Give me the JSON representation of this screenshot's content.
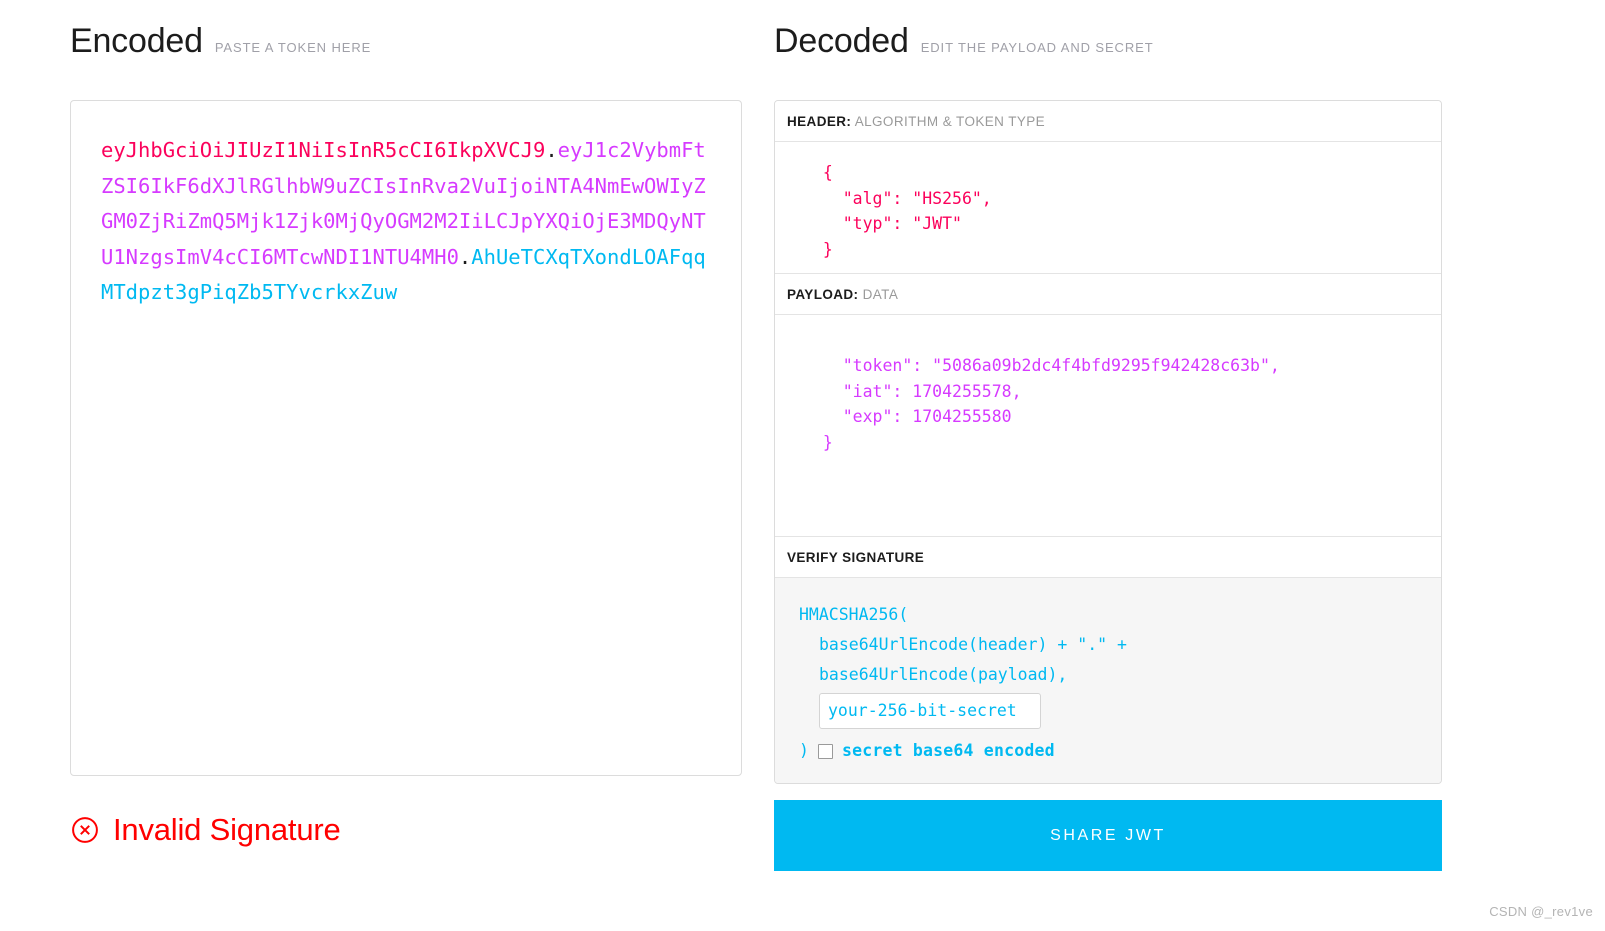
{
  "encoded": {
    "title": "Encoded",
    "subtitle": "PASTE A TOKEN HERE",
    "token": {
      "header_part": "eyJhbGciOiJIUzI1NiIsInR5cCI6IkpXVCJ9",
      "dot1": ".",
      "payload_part": "eyJ1c2VybmFtZSI6IkF6dXJlRGlhbW9uZCIsInRva2VuIjoiNTA4NmEwOWIyZGM0ZjRiZmQ5Mjk1Zjk0MjQyOGM2M2IiLCJpYXQiOjE3MDQyNTU1NzgsImV4cCI6MTcwNDI1NTU4MH0",
      "dot2": ".",
      "signature_part": "AhUeTCXqTXondLOAFqqMTdpzt3gPiqZb5TYvcrkxZuw"
    }
  },
  "status": {
    "icon": "circle-x-icon",
    "text": "Invalid Signature",
    "color": "#ff0000"
  },
  "decoded": {
    "title": "Decoded",
    "subtitle": "EDIT THE PAYLOAD AND SECRET",
    "header_section": {
      "label_key": "HEADER:",
      "label_value": "ALGORITHM & TOKEN TYPE",
      "json": "  {\n    \"alg\": \"HS256\",\n    \"typ\": \"JWT\"\n  }"
    },
    "payload_section": {
      "label_key": "PAYLOAD:",
      "label_value": "DATA",
      "json": "    \"token\": \"5086a09b2dc4f4bfd9295f942428c63b\",\n    \"iat\": 1704255578,\n    \"exp\": 1704255580\n  }"
    },
    "signature_section": {
      "label_key": "VERIFY SIGNATURE",
      "label_value": "",
      "line1": "HMACSHA256(",
      "line2": "base64UrlEncode(header) + \".\" +",
      "line3": "base64UrlEncode(payload),",
      "secret_value": "your-256-bit-secret",
      "secret_placeholder": "your-256-bit-secret",
      "close_paren": ")",
      "base64_label": "secret base64 encoded",
      "base64_checked": false
    }
  },
  "share_button": {
    "label": "SHARE JWT"
  },
  "watermark": {
    "text": "CSDN @_rev1ve"
  },
  "colors": {
    "header_pink": "#fb015b",
    "payload_magenta": "#d63aff",
    "signature_blue": "#00b9f1",
    "error_red": "#ff0000",
    "accent": "#00b9f1"
  }
}
